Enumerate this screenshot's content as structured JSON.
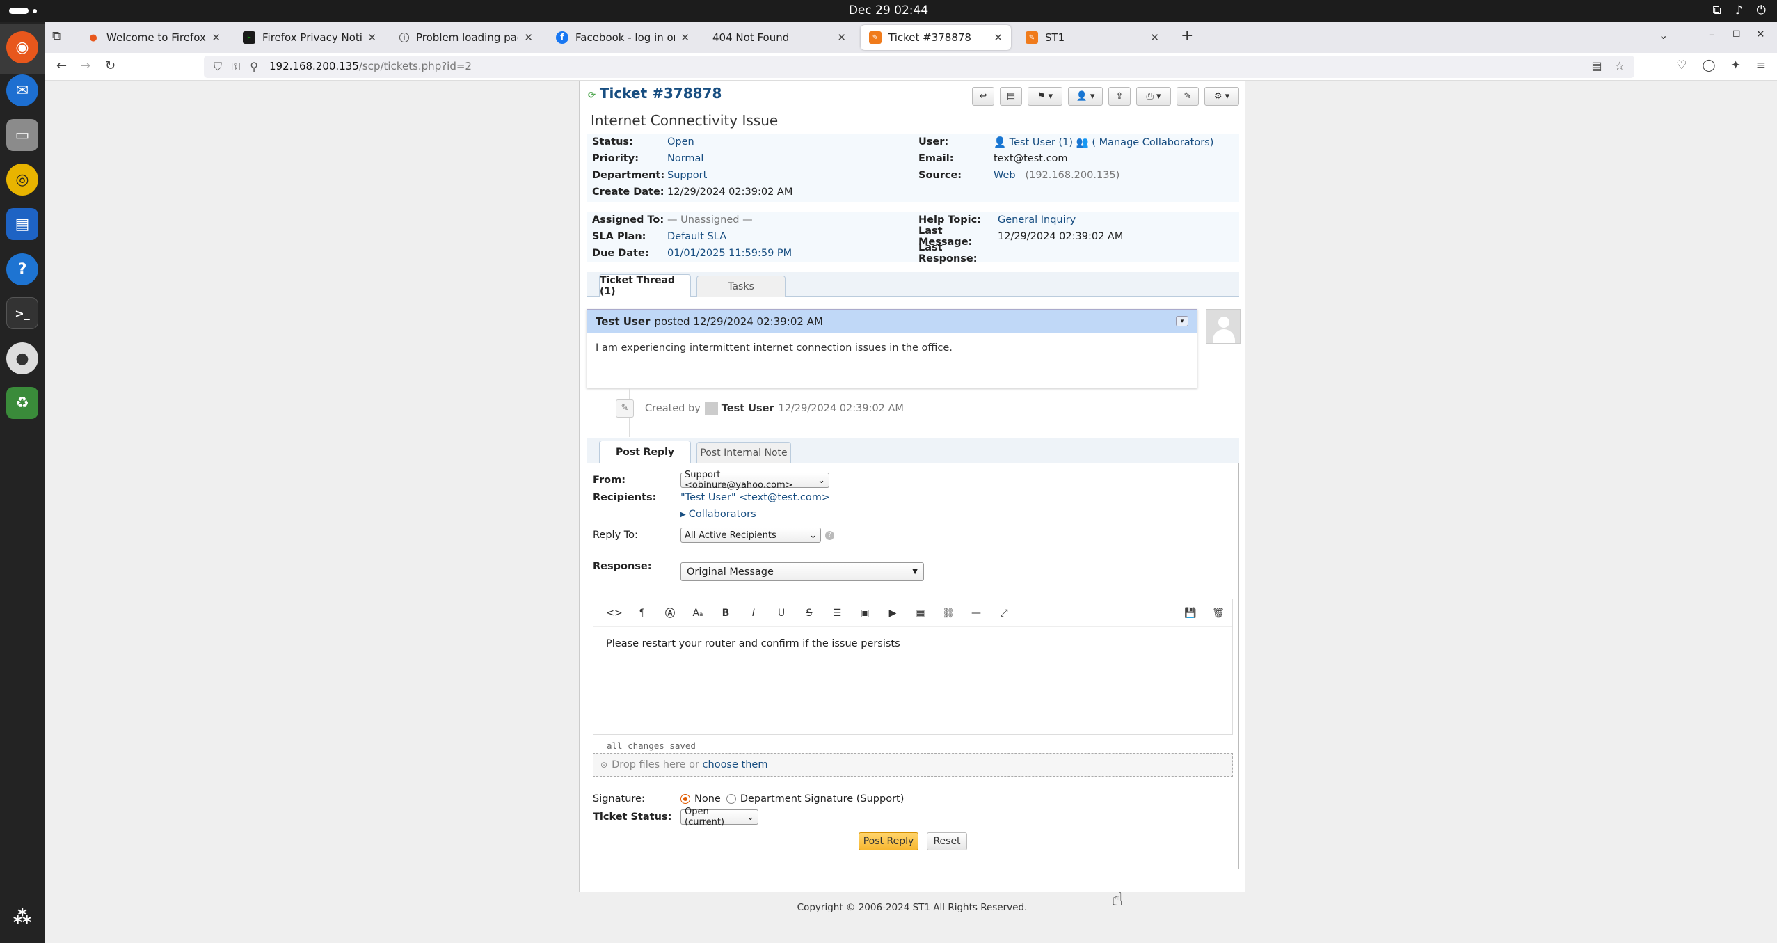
{
  "system": {
    "clock": "Dec 29  02:44"
  },
  "browser": {
    "tabs": [
      {
        "title": "Welcome to Firefox",
        "icon": "firefox-icon"
      },
      {
        "title": "Firefox Privacy Notice —",
        "icon": "privacy-icon"
      },
      {
        "title": "Problem loading page",
        "icon": "info-icon"
      },
      {
        "title": "Facebook - log in or sign",
        "icon": "facebook-icon"
      },
      {
        "title": "404 Not Found",
        "icon": ""
      },
      {
        "title": "Ticket #378878",
        "icon": "osticket-icon"
      },
      {
        "title": "ST1",
        "icon": "osticket-icon"
      }
    ],
    "url_host": "192.168.200.135",
    "url_path": "/scp/tickets.php?id=2"
  },
  "ticket": {
    "number": "Ticket #378878",
    "subject": "Internet Connectivity Issue",
    "left1": [
      {
        "label": "Status:",
        "value": "Open",
        "link": true
      },
      {
        "label": "Priority:",
        "value": "Normal",
        "link": true
      },
      {
        "label": "Department:",
        "value": "Support",
        "link": true
      },
      {
        "label": "Create Date:",
        "value": "12/29/2024 02:39:02 AM",
        "link": false
      }
    ],
    "user_label": "User:",
    "user_value": "Test User (1)",
    "collab_value": "( Manage Collaborators)",
    "email_label": "Email:",
    "email_value": "text@test.com",
    "source_label": "Source:",
    "source_value": "Web",
    "source_ip": "(192.168.200.135)",
    "left2": [
      {
        "label": "Assigned To:",
        "value": "— Unassigned —",
        "link": false,
        "muted": true
      },
      {
        "label": "SLA Plan:",
        "value": "Default SLA",
        "link": true
      },
      {
        "label": "Due Date:",
        "value": "01/01/2025 11:59:59 PM",
        "link": true
      }
    ],
    "right2": [
      {
        "label": "Help Topic:",
        "value": "General Inquiry",
        "link": true
      },
      {
        "label": "Last Message:",
        "value": "12/29/2024 02:39:02 AM",
        "link": false
      },
      {
        "label": "Last Response:",
        "value": "",
        "link": false
      }
    ]
  },
  "thread_tabs": {
    "thread": "Ticket Thread (1)",
    "tasks": "Tasks"
  },
  "thread": {
    "author": "Test User",
    "posted": "posted 12/29/2024 02:39:02 AM",
    "body": "I am experiencing intermittent internet connection issues in the office.",
    "event_prefix": "Created by",
    "event_user": "Test User",
    "event_date": "12/29/2024 02:39:02 AM"
  },
  "reply_tabs": {
    "reply": "Post Reply",
    "note": "Post Internal Note"
  },
  "reply": {
    "from_label": "From:",
    "from_value": "Support <obinure@yahoo.com>",
    "recipients_label": "Recipients:",
    "recipients_value": "\"Test User\" <text@test.com>",
    "collaborators": "Collaborators",
    "replyto_label": "Reply To:",
    "replyto_value": "All Active Recipients",
    "response_label": "Response:",
    "response_value": "Original Message",
    "editor_text": "Please restart your router and confirm if the issue persists",
    "saved": "all changes saved",
    "drop_text": "Drop files here or",
    "drop_link": "choose them",
    "signature_label": "Signature:",
    "sig_none": "None",
    "sig_dept": "Department Signature (Support)",
    "status_label": "Ticket Status:",
    "status_value": "Open (current)",
    "post_button": "Post Reply",
    "reset_button": "Reset"
  },
  "footer": {
    "copyright": "Copyright © 2006-2024 ST1 All Rights Reserved."
  }
}
